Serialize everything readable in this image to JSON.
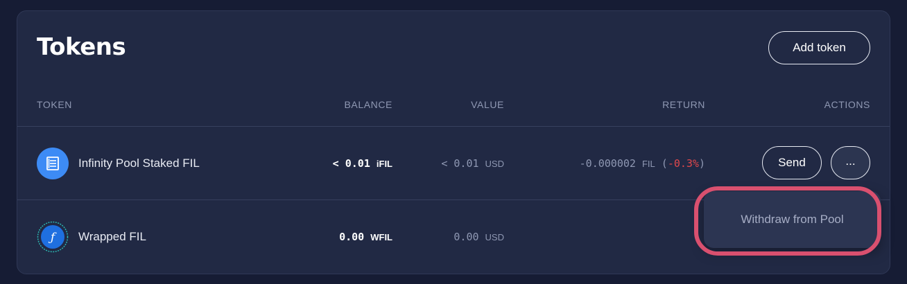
{
  "card": {
    "title": "Tokens",
    "add_button_label": "Add token"
  },
  "columns": {
    "token": "TOKEN",
    "balance": "BALANCE",
    "value": "VALUE",
    "return": "RETURN",
    "actions": "ACTIONS"
  },
  "rows": [
    {
      "icon": "ifil-token-icon",
      "name": "Infinity Pool Staked FIL",
      "balance": "< 0.01",
      "balance_unit": "iFIL",
      "value": "< 0.01",
      "value_unit": "USD",
      "return_amount": "-0.000002",
      "return_unit": "FIL",
      "return_open": "(",
      "return_pct": "-0.3%",
      "return_close": ")",
      "send_label": "Send",
      "more_label": "..."
    },
    {
      "icon": "wfil-token-icon",
      "name": "Wrapped FIL",
      "balance": "0.00",
      "balance_unit": "WFIL",
      "value": "0.00",
      "value_unit": "USD"
    }
  ],
  "dropdown": {
    "items": [
      "Withdraw from Pool"
    ]
  },
  "colors": {
    "background": "#161c34",
    "card": "#212944",
    "negative": "#e0484c",
    "highlight": "#d9506f",
    "ifil_icon": "#3d8bf5",
    "wfil_icon": "#1f6fe0"
  }
}
